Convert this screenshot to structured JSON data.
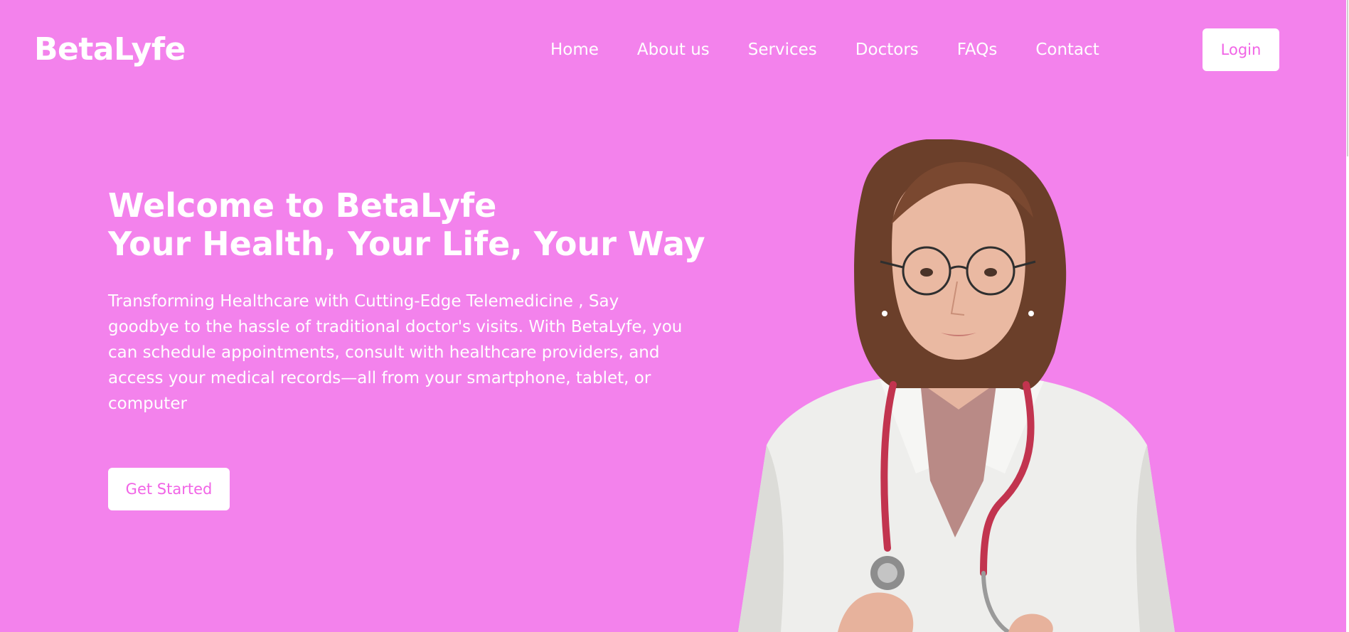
{
  "header": {
    "logo": "BetaLyfe",
    "nav": [
      {
        "label": "Home"
      },
      {
        "label": "About us"
      },
      {
        "label": "Services"
      },
      {
        "label": "Doctors"
      },
      {
        "label": "FAQs"
      },
      {
        "label": "Contact"
      }
    ],
    "login_label": "Login"
  },
  "hero": {
    "title_line1": "Welcome to BetaLyfe",
    "title_line2": "Your Health, Your Life, Your Way",
    "description": "Transforming Healthcare with Cutting-Edge Telemedicine , Say goodbye to the hassle of traditional doctor's visits. With BetaLyfe, you can schedule appointments, consult with healthcare providers, and access your medical records—all from your smartphone, tablet, or computer",
    "cta_label": "Get Started",
    "image": "doctor-photo"
  },
  "colors": {
    "background": "#f382ec",
    "accent_text": "#f164e6",
    "white": "#ffffff"
  }
}
